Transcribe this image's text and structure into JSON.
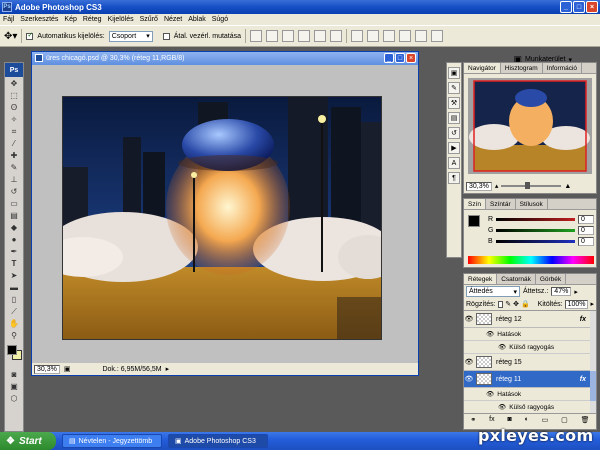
{
  "app": {
    "title": "Adobe Photoshop CS3",
    "icon_text": "Ps"
  },
  "window_buttons": [
    "_",
    "□",
    "×"
  ],
  "menu": [
    "Fájl",
    "Szerkesztés",
    "Kép",
    "Réteg",
    "Kijelölés",
    "Szűrő",
    "Nézet",
    "Ablak",
    "Súgó"
  ],
  "options": {
    "auto_select_label": "Automatikus kijelölés:",
    "auto_select_checked": true,
    "auto_select_value": "Csoport",
    "show_transform_label": "Átal. vezérl. mutatása",
    "show_transform_checked": false,
    "workspace_label": "Munkaterület"
  },
  "toolbox": {
    "header": "Ps"
  },
  "document": {
    "title": "üres chicagó.psd @ 30,3% (réteg 11,RGB/8)",
    "zoom": "30,3%",
    "doc_info": "Dok.: 6,95M/56,5M"
  },
  "navigator": {
    "tabs": [
      "Navigátor",
      "Hisztogram",
      "Információ"
    ],
    "zoom": "30,3%"
  },
  "color_panel": {
    "tabs": [
      "Szín",
      "Színtár",
      "Stílusok"
    ],
    "channels": [
      {
        "label": "R",
        "value": "0",
        "color": "#c02020"
      },
      {
        "label": "G",
        "value": "0",
        "color": "#20a020"
      },
      {
        "label": "B",
        "value": "0",
        "color": "#2030c0"
      }
    ]
  },
  "layers": {
    "tabs": [
      "Rétegek",
      "Csatornák",
      "Görbék"
    ],
    "blend_mode": "Áttedés",
    "opacity_label": "Áttetsz.:",
    "opacity": "47%",
    "lock_label": "Rögzítés:",
    "fill_label": "Kitöltés:",
    "fill": "100%",
    "rows": [
      {
        "kind": "layer",
        "name": "réteg 12",
        "fx": true,
        "selected": false
      },
      {
        "kind": "effects",
        "name": "Hatások"
      },
      {
        "kind": "effect",
        "name": "Külső ragyogás"
      },
      {
        "kind": "layer",
        "name": "réteg 15",
        "fx": false,
        "selected": false
      },
      {
        "kind": "layer",
        "name": "réteg 11",
        "fx": true,
        "selected": true
      },
      {
        "kind": "effects",
        "name": "Hatások"
      },
      {
        "kind": "effect",
        "name": "Külső ragyogás"
      }
    ]
  },
  "taskbar": {
    "start": "Start",
    "items": [
      {
        "label": "Névtelen - Jegyzettömb",
        "active": false
      },
      {
        "label": "Adobe Photoshop CS3",
        "active": true
      }
    ]
  },
  "watermark": "pxleyes.com"
}
